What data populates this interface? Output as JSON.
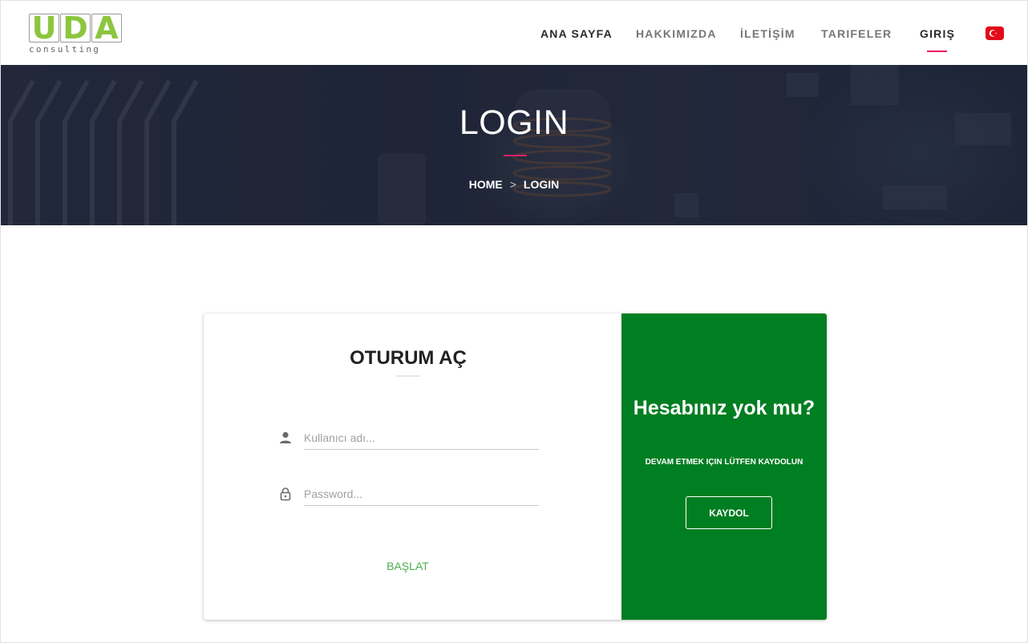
{
  "header": {
    "logo": {
      "letters": [
        "U",
        "D",
        "A"
      ],
      "tagline": "consulting",
      "color": "#8cc63f"
    },
    "nav": [
      {
        "label": "ANA SAYFA"
      },
      {
        "label": "HAKKIMIZDA"
      },
      {
        "label": "İLETİŞİM"
      },
      {
        "label": "TARIFELER"
      },
      {
        "label": "GIRIŞ",
        "active": true
      }
    ],
    "language_flag": "turkey-flag-icon",
    "accent": "#e91e63"
  },
  "hero": {
    "title": "LOGIN",
    "breadcrumb": {
      "home": "HOME",
      "separator": ">",
      "current": "LOGIN"
    }
  },
  "login": {
    "title": "OTURUM AÇ",
    "username": {
      "placeholder": "Kullanıcı adı...",
      "value": "",
      "icon": "person-icon"
    },
    "password": {
      "placeholder": "Password...",
      "value": "",
      "icon": "lock-icon"
    },
    "submit_label": "BAŞLAT",
    "submit_color": "#4caf50"
  },
  "signup": {
    "title": "Hesabınız yok mu?",
    "subtitle": "DEVAM ETMEK IÇIN LÜTFEN KAYDOLUN",
    "button_label": "KAYDOL",
    "background": "#007e22"
  }
}
